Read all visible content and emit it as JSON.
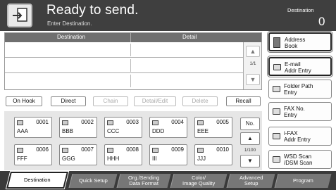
{
  "header": {
    "title": "Ready to send.",
    "subtitle": "Enter Destination.",
    "destination_label": "Destination",
    "destination_count": "0"
  },
  "table": {
    "col_destination": "Destination",
    "col_detail": "Detail",
    "page_indicator": "1/1"
  },
  "right_buttons": [
    {
      "line1": "Address",
      "line2": "Book"
    },
    {
      "line1": "E-mail",
      "line2": "Addr Entry"
    },
    {
      "line1": "Folder Path",
      "line2": "Entry"
    },
    {
      "line1": "FAX No.",
      "line2": "Entry"
    },
    {
      "line1": "i-FAX",
      "line2": "Addr Entry"
    },
    {
      "line1": "WSD Scan",
      "line2": "/DSM Scan"
    }
  ],
  "toolbar": {
    "on_hook": "On Hook",
    "direct": "Direct",
    "chain": "Chain",
    "detail_edit": "Detail/Edit",
    "delete": "Delete",
    "recall": "Recall"
  },
  "keys": [
    {
      "num": "0001",
      "name": "AAA"
    },
    {
      "num": "0002",
      "name": "BBB"
    },
    {
      "num": "0003",
      "name": "CCC"
    },
    {
      "num": "0004",
      "name": "DDD"
    },
    {
      "num": "0005",
      "name": "EEE"
    },
    {
      "num": "0006",
      "name": "FFF"
    },
    {
      "num": "0007",
      "name": "GGG"
    },
    {
      "num": "0008",
      "name": "HHH"
    },
    {
      "num": "0009",
      "name": "III"
    },
    {
      "num": "0010",
      "name": "JJJ"
    }
  ],
  "keys_side": {
    "no_label": "No.",
    "page_indicator": "1/100"
  },
  "tabs": [
    {
      "line1": "Destination",
      "line2": ""
    },
    {
      "line1": "Quick Setup",
      "line2": ""
    },
    {
      "line1": "Org./Sending",
      "line2": "Data Format"
    },
    {
      "line1": "Color/",
      "line2": "Image Quality"
    },
    {
      "line1": "Advanced",
      "line2": "Setup"
    },
    {
      "line1": "Program",
      "line2": ""
    }
  ]
}
